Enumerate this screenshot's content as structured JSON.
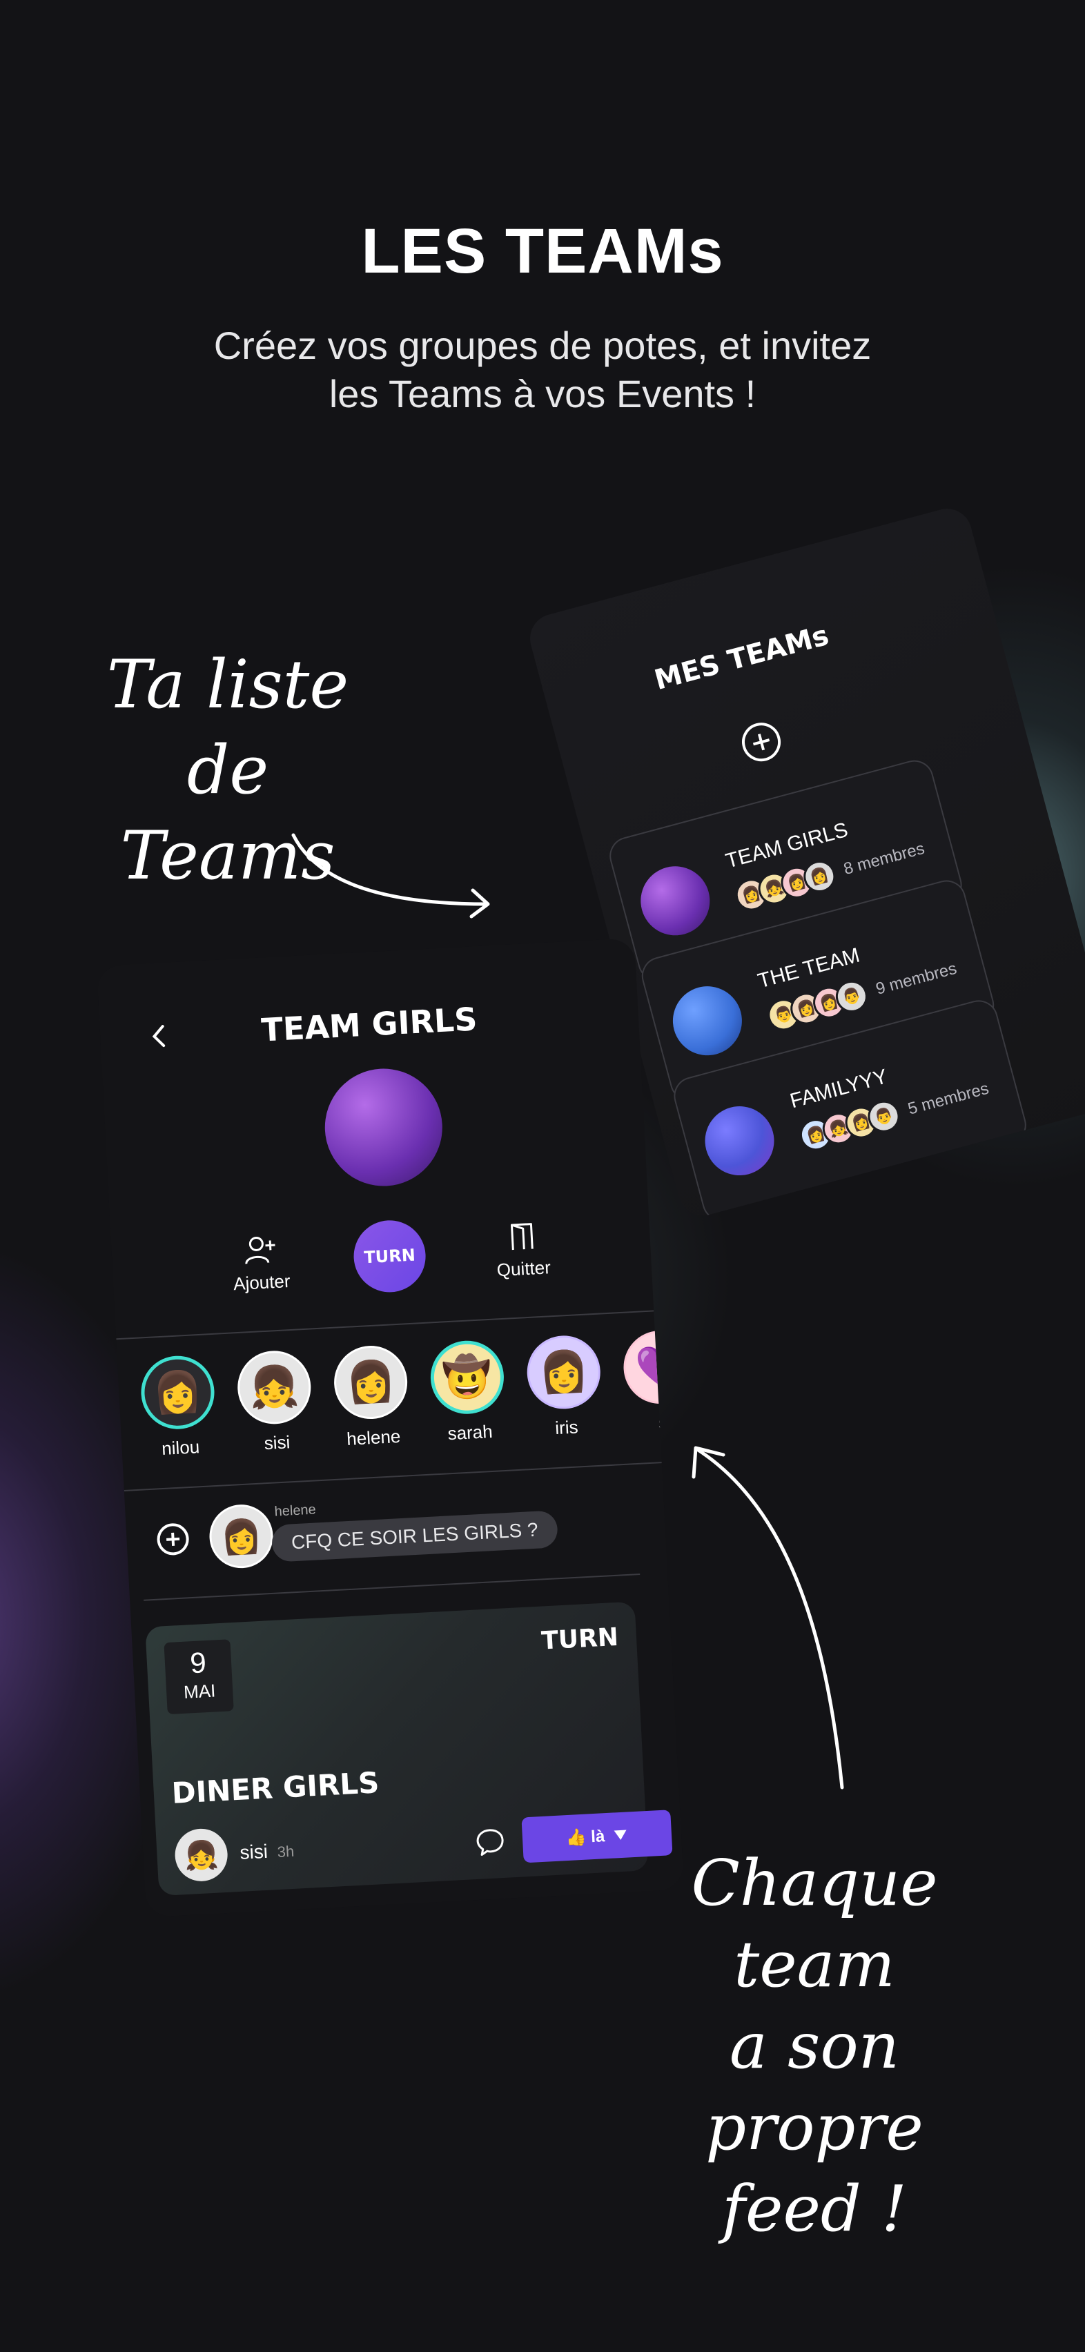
{
  "header": {
    "title": "LES TEAMs",
    "subtitle_line1": "Créez vos groupes de potes, et invitez",
    "subtitle_line2": "les Teams à vos Events !"
  },
  "annotations": {
    "list_line1": "Ta liste de",
    "list_line2": "Teams",
    "feed_line1": "Chaque team",
    "feed_line2": "a son propre",
    "feed_line3": "feed !"
  },
  "teams_screen": {
    "title": "MES TEAMs",
    "teams": [
      {
        "name": "TEAM GIRLS",
        "members": "8 membres",
        "color": "#7b3fbf"
      },
      {
        "name": "THE TEAM",
        "members": "9 membres",
        "color": "#3a6fd8"
      },
      {
        "name": "FAMILYYY",
        "members": "5 membres",
        "color": "#4d55d8"
      }
    ]
  },
  "team_screen": {
    "title": "TEAM GIRLS",
    "actions": {
      "add": "Ajouter",
      "turn": "TURN",
      "quit": "Quitter"
    },
    "members": [
      {
        "name": "nilou",
        "emoji": "👩",
        "ring": "#3fe0d0"
      },
      {
        "name": "sisi",
        "emoji": "👧",
        "ring": "#ffffff"
      },
      {
        "name": "helene",
        "emoji": "👩‍🦰",
        "ring": "#ffffff"
      },
      {
        "name": "sarah",
        "emoji": "🤠",
        "ring": "#3fe0d0"
      },
      {
        "name": "iris",
        "emoji": "👩‍🦳",
        "ring": "#c9b8ff"
      },
      {
        "name": "s",
        "emoji": "💜",
        "ring": "#ffc9d8"
      }
    ],
    "message": {
      "author": "helene",
      "text": "CFQ CE SOIR LES GIRLS ?"
    },
    "event": {
      "day": "9",
      "month": "MAI",
      "brand": "TURN",
      "title": "DINER GIRLS",
      "author": "sisi",
      "time": "3h",
      "reaction_label": "👍 là"
    }
  },
  "colors": {
    "background": "#131316",
    "accent_purple": "#6b46e5",
    "ring_teal": "#3fe0d0"
  }
}
